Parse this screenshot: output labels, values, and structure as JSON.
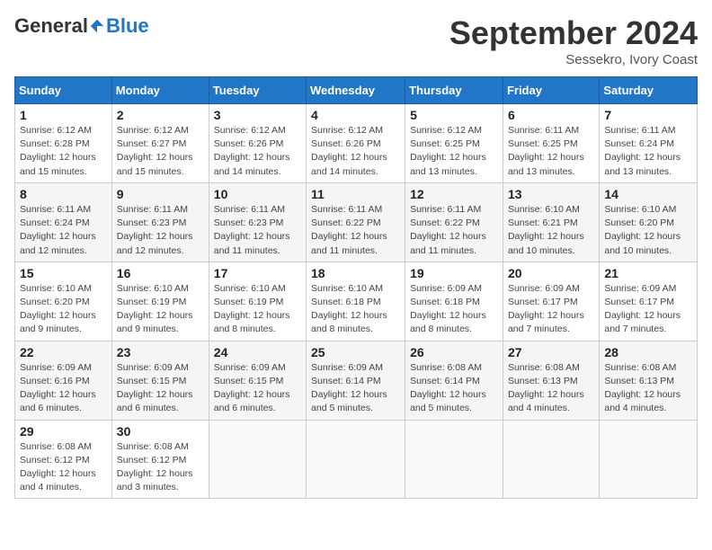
{
  "header": {
    "logo_general": "General",
    "logo_blue": "Blue",
    "month_title": "September 2024",
    "location": "Sessekro, Ivory Coast"
  },
  "calendar": {
    "days_of_week": [
      "Sunday",
      "Monday",
      "Tuesday",
      "Wednesday",
      "Thursday",
      "Friday",
      "Saturday"
    ],
    "weeks": [
      [
        {
          "day": "1",
          "sunrise": "6:12 AM",
          "sunset": "6:28 PM",
          "daylight": "12 hours and 15 minutes."
        },
        {
          "day": "2",
          "sunrise": "6:12 AM",
          "sunset": "6:27 PM",
          "daylight": "12 hours and 15 minutes."
        },
        {
          "day": "3",
          "sunrise": "6:12 AM",
          "sunset": "6:26 PM",
          "daylight": "12 hours and 14 minutes."
        },
        {
          "day": "4",
          "sunrise": "6:12 AM",
          "sunset": "6:26 PM",
          "daylight": "12 hours and 14 minutes."
        },
        {
          "day": "5",
          "sunrise": "6:12 AM",
          "sunset": "6:25 PM",
          "daylight": "12 hours and 13 minutes."
        },
        {
          "day": "6",
          "sunrise": "6:11 AM",
          "sunset": "6:25 PM",
          "daylight": "12 hours and 13 minutes."
        },
        {
          "day": "7",
          "sunrise": "6:11 AM",
          "sunset": "6:24 PM",
          "daylight": "12 hours and 13 minutes."
        }
      ],
      [
        {
          "day": "8",
          "sunrise": "6:11 AM",
          "sunset": "6:24 PM",
          "daylight": "12 hours and 12 minutes."
        },
        {
          "day": "9",
          "sunrise": "6:11 AM",
          "sunset": "6:23 PM",
          "daylight": "12 hours and 12 minutes."
        },
        {
          "day": "10",
          "sunrise": "6:11 AM",
          "sunset": "6:23 PM",
          "daylight": "12 hours and 11 minutes."
        },
        {
          "day": "11",
          "sunrise": "6:11 AM",
          "sunset": "6:22 PM",
          "daylight": "12 hours and 11 minutes."
        },
        {
          "day": "12",
          "sunrise": "6:11 AM",
          "sunset": "6:22 PM",
          "daylight": "12 hours and 11 minutes."
        },
        {
          "day": "13",
          "sunrise": "6:10 AM",
          "sunset": "6:21 PM",
          "daylight": "12 hours and 10 minutes."
        },
        {
          "day": "14",
          "sunrise": "6:10 AM",
          "sunset": "6:20 PM",
          "daylight": "12 hours and 10 minutes."
        }
      ],
      [
        {
          "day": "15",
          "sunrise": "6:10 AM",
          "sunset": "6:20 PM",
          "daylight": "12 hours and 9 minutes."
        },
        {
          "day": "16",
          "sunrise": "6:10 AM",
          "sunset": "6:19 PM",
          "daylight": "12 hours and 9 minutes."
        },
        {
          "day": "17",
          "sunrise": "6:10 AM",
          "sunset": "6:19 PM",
          "daylight": "12 hours and 8 minutes."
        },
        {
          "day": "18",
          "sunrise": "6:10 AM",
          "sunset": "6:18 PM",
          "daylight": "12 hours and 8 minutes."
        },
        {
          "day": "19",
          "sunrise": "6:09 AM",
          "sunset": "6:18 PM",
          "daylight": "12 hours and 8 minutes."
        },
        {
          "day": "20",
          "sunrise": "6:09 AM",
          "sunset": "6:17 PM",
          "daylight": "12 hours and 7 minutes."
        },
        {
          "day": "21",
          "sunrise": "6:09 AM",
          "sunset": "6:17 PM",
          "daylight": "12 hours and 7 minutes."
        }
      ],
      [
        {
          "day": "22",
          "sunrise": "6:09 AM",
          "sunset": "6:16 PM",
          "daylight": "12 hours and 6 minutes."
        },
        {
          "day": "23",
          "sunrise": "6:09 AM",
          "sunset": "6:15 PM",
          "daylight": "12 hours and 6 minutes."
        },
        {
          "day": "24",
          "sunrise": "6:09 AM",
          "sunset": "6:15 PM",
          "daylight": "12 hours and 6 minutes."
        },
        {
          "day": "25",
          "sunrise": "6:09 AM",
          "sunset": "6:14 PM",
          "daylight": "12 hours and 5 minutes."
        },
        {
          "day": "26",
          "sunrise": "6:08 AM",
          "sunset": "6:14 PM",
          "daylight": "12 hours and 5 minutes."
        },
        {
          "day": "27",
          "sunrise": "6:08 AM",
          "sunset": "6:13 PM",
          "daylight": "12 hours and 4 minutes."
        },
        {
          "day": "28",
          "sunrise": "6:08 AM",
          "sunset": "6:13 PM",
          "daylight": "12 hours and 4 minutes."
        }
      ],
      [
        {
          "day": "29",
          "sunrise": "6:08 AM",
          "sunset": "6:12 PM",
          "daylight": "12 hours and 4 minutes."
        },
        {
          "day": "30",
          "sunrise": "6:08 AM",
          "sunset": "6:12 PM",
          "daylight": "12 hours and 3 minutes."
        },
        null,
        null,
        null,
        null,
        null
      ]
    ]
  }
}
